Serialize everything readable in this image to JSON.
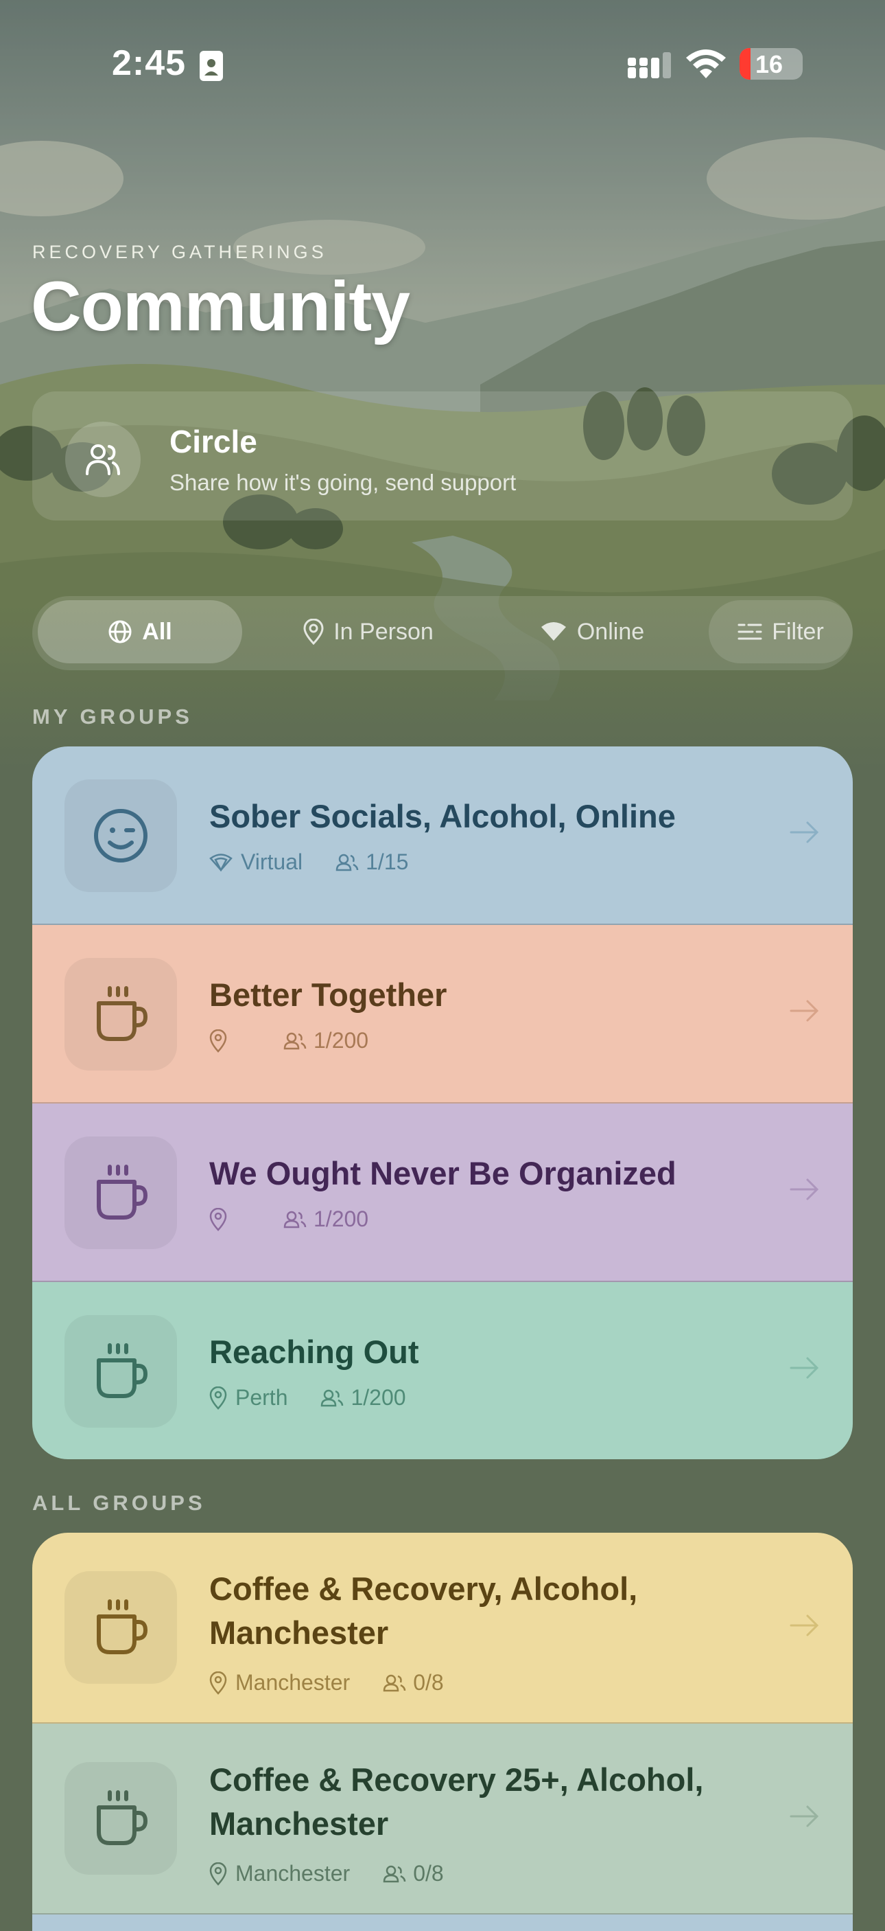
{
  "status_bar": {
    "time": "2:45",
    "battery": "16"
  },
  "header": {
    "eyebrow": "RECOVERY GATHERINGS",
    "title": "Community"
  },
  "circle": {
    "title": "Circle",
    "subtitle": "Share how it's going, send support"
  },
  "filters": [
    {
      "label": "All",
      "icon": "globe-icon",
      "active": true
    },
    {
      "label": "In Person",
      "icon": "location-pin-icon",
      "active": false
    },
    {
      "label": "Online",
      "icon": "wifi-icon",
      "active": false
    },
    {
      "label": "Filter",
      "icon": "filter-lines-icon",
      "active": false
    }
  ],
  "my_groups": {
    "label": "MY GROUPS",
    "items": [
      {
        "name": "Sober Socials, Alcohol, Online",
        "icon": "winking-face-icon",
        "location_icon": "wifi-icon",
        "location": "Virtual",
        "members": "1/15",
        "color": "#b1c9d8"
      },
      {
        "name": "Better Together",
        "icon": "coffee-cup-icon",
        "location_icon": "location-pin-icon",
        "location": "",
        "members": "1/200",
        "color": "#f1c4b0"
      },
      {
        "name": "We Ought Never Be Organized",
        "icon": "coffee-cup-icon",
        "location_icon": "location-pin-icon",
        "location": "",
        "members": "1/200",
        "color": "#c9b8d6"
      },
      {
        "name": "Reaching Out",
        "icon": "coffee-cup-icon",
        "location_icon": "location-pin-icon",
        "location": "Perth",
        "members": "1/200",
        "color": "#a7d4c3"
      }
    ]
  },
  "all_groups": {
    "label": "ALL GROUPS",
    "items": [
      {
        "name": "Coffee & Recovery, Alcohol, Manchester",
        "icon": "coffee-cup-icon",
        "location_icon": "location-pin-icon",
        "location": "Manchester",
        "members": "0/8",
        "color": "#eedb9f"
      },
      {
        "name": "Coffee & Recovery 25+, Alcohol, Manchester",
        "icon": "coffee-cup-icon",
        "location_icon": "location-pin-icon",
        "location": "Manchester",
        "members": "0/8",
        "color": "#b7cebd"
      }
    ]
  }
}
